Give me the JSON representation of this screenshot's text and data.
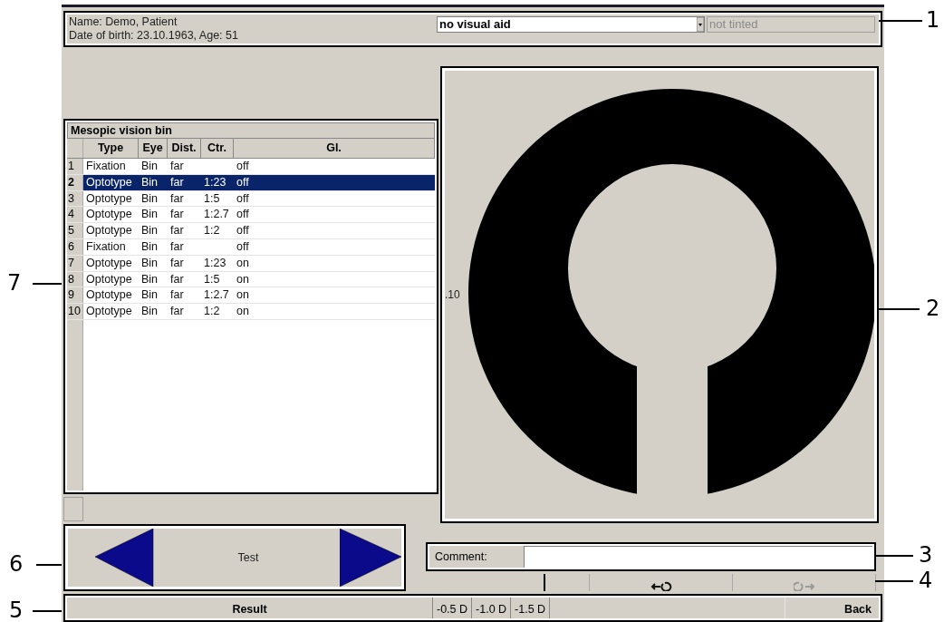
{
  "patient": {
    "name_line": "Name: Demo, Patient",
    "birth_line": "Date of birth: 23.10.1963, Age: 51"
  },
  "visual_aid": {
    "value": "no visual aid"
  },
  "tint": {
    "value": "not tinted",
    "disabled": true
  },
  "table": {
    "title": "Mesopic vision bin",
    "columns": [
      "Type",
      "Eye",
      "Dist.",
      "Ctr.",
      "Gl."
    ],
    "rows": [
      {
        "number": "1",
        "cells": [
          "Fixation",
          "Bin",
          "far",
          "",
          "off"
        ],
        "selected": false
      },
      {
        "number": "2",
        "cells": [
          "Optotype",
          "Bin",
          "far",
          "1:23",
          "off"
        ],
        "selected": true
      },
      {
        "number": "3",
        "cells": [
          "Optotype",
          "Bin",
          "far",
          "1:5",
          "off"
        ],
        "selected": false
      },
      {
        "number": "4",
        "cells": [
          "Optotype",
          "Bin",
          "far",
          "1:2.7",
          "off"
        ],
        "selected": false
      },
      {
        "number": "5",
        "cells": [
          "Optotype",
          "Bin",
          "far",
          "1:2",
          "off"
        ],
        "selected": false
      },
      {
        "number": "6",
        "cells": [
          "Fixation",
          "Bin",
          "far",
          "",
          "off"
        ],
        "selected": false
      },
      {
        "number": "7",
        "cells": [
          "Optotype",
          "Bin",
          "far",
          "1:23",
          "on"
        ],
        "selected": false
      },
      {
        "number": "8",
        "cells": [
          "Optotype",
          "Bin",
          "far",
          "1:5",
          "on"
        ],
        "selected": false
      },
      {
        "number": "9",
        "cells": [
          "Optotype",
          "Bin",
          "far",
          "1:2.7",
          "on"
        ],
        "selected": false
      },
      {
        "number": "10",
        "cells": [
          "Optotype",
          "Bin",
          "far",
          "1:2",
          "on"
        ],
        "selected": false
      }
    ]
  },
  "optotype": {
    "value_label": ".10"
  },
  "navigation": {
    "label": "Test"
  },
  "comment": {
    "label": "Comment:"
  },
  "rotate_buttons": [
    {
      "kind": "rotate-left",
      "disabled": false
    },
    {
      "kind": "rotate-right",
      "disabled": true
    }
  ],
  "bottom_bar": {
    "result": "Result",
    "corrections": [
      "-0.5 D",
      "-1.0 D",
      "-1.5 D"
    ],
    "back": "Back"
  },
  "callouts": [
    "7",
    "6",
    "5",
    "1",
    "2",
    "3",
    "4"
  ]
}
